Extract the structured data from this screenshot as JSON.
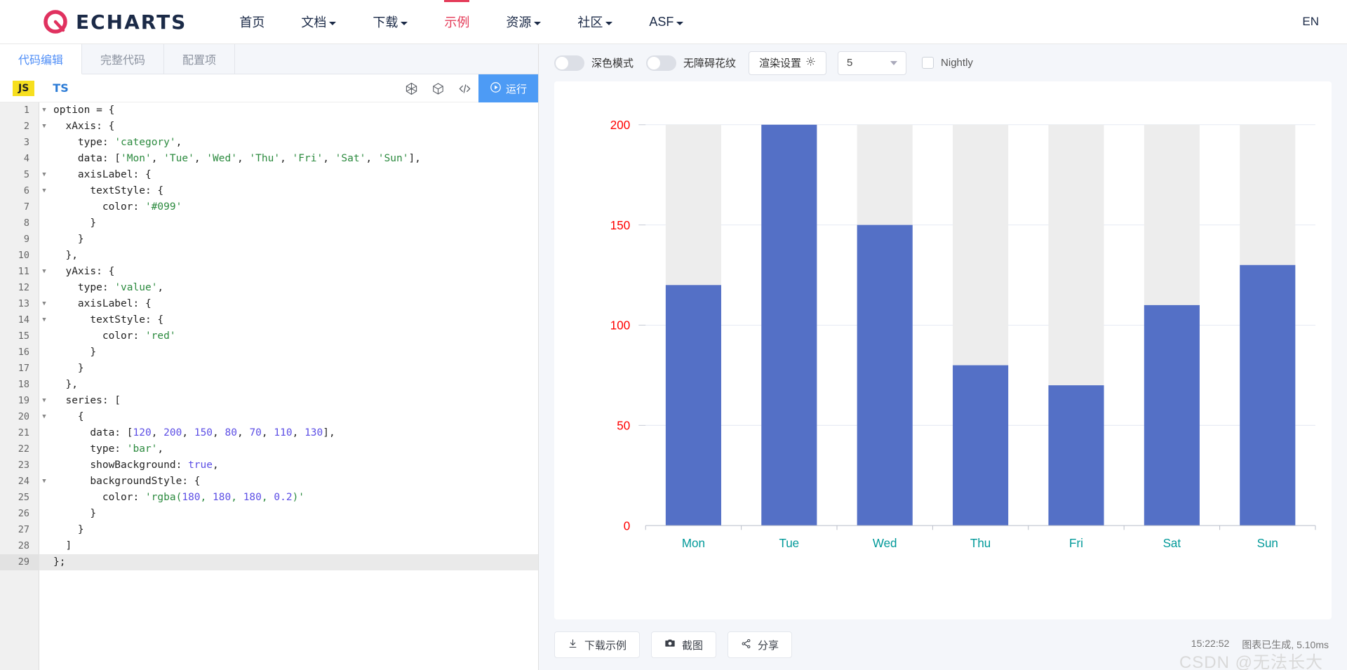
{
  "nav": {
    "brand": "ECHARTS",
    "items": [
      {
        "label": "首页",
        "dropdown": false,
        "active": false
      },
      {
        "label": "文档",
        "dropdown": true,
        "active": false
      },
      {
        "label": "下载",
        "dropdown": true,
        "active": false
      },
      {
        "label": "示例",
        "dropdown": false,
        "active": true
      },
      {
        "label": "资源",
        "dropdown": true,
        "active": false
      },
      {
        "label": "社区",
        "dropdown": true,
        "active": false
      },
      {
        "label": "ASF",
        "dropdown": true,
        "active": false
      }
    ],
    "lang_switch": "EN"
  },
  "editor": {
    "tabs": [
      {
        "label": "代码编辑",
        "active": true
      },
      {
        "label": "完整代码",
        "active": false
      },
      {
        "label": "配置项",
        "active": false
      }
    ],
    "lang_js": "JS",
    "lang_ts": "TS",
    "tool_icons": [
      "cube-wire-icon",
      "cube-icon",
      "code-brackets-icon"
    ],
    "run_label": "运行",
    "active_line": 29,
    "lines": [
      {
        "n": 1,
        "fold": true,
        "text": "option = {"
      },
      {
        "n": 2,
        "fold": true,
        "text": "  xAxis: {"
      },
      {
        "n": 3,
        "fold": false,
        "text": "    type: 'category',"
      },
      {
        "n": 4,
        "fold": false,
        "text": "    data: ['Mon', 'Tue', 'Wed', 'Thu', 'Fri', 'Sat', 'Sun'],"
      },
      {
        "n": 5,
        "fold": true,
        "text": "    axisLabel: {"
      },
      {
        "n": 6,
        "fold": true,
        "text": "      textStyle: {"
      },
      {
        "n": 7,
        "fold": false,
        "text": "        color: '#099'"
      },
      {
        "n": 8,
        "fold": false,
        "text": "      }"
      },
      {
        "n": 9,
        "fold": false,
        "text": "    }"
      },
      {
        "n": 10,
        "fold": false,
        "text": "  },"
      },
      {
        "n": 11,
        "fold": true,
        "text": "  yAxis: {"
      },
      {
        "n": 12,
        "fold": false,
        "text": "    type: 'value',"
      },
      {
        "n": 13,
        "fold": true,
        "text": "    axisLabel: {"
      },
      {
        "n": 14,
        "fold": true,
        "text": "      textStyle: {"
      },
      {
        "n": 15,
        "fold": false,
        "text": "        color: 'red'"
      },
      {
        "n": 16,
        "fold": false,
        "text": "      }"
      },
      {
        "n": 17,
        "fold": false,
        "text": "    }"
      },
      {
        "n": 18,
        "fold": false,
        "text": "  },"
      },
      {
        "n": 19,
        "fold": true,
        "text": "  series: ["
      },
      {
        "n": 20,
        "fold": true,
        "text": "    {"
      },
      {
        "n": 21,
        "fold": false,
        "text": "      data: [120, 200, 150, 80, 70, 110, 130],"
      },
      {
        "n": 22,
        "fold": false,
        "text": "      type: 'bar',"
      },
      {
        "n": 23,
        "fold": false,
        "text": "      showBackground: true,"
      },
      {
        "n": 24,
        "fold": true,
        "text": "      backgroundStyle: {"
      },
      {
        "n": 25,
        "fold": false,
        "text": "        color: 'rgba(180, 180, 180, 0.2)'"
      },
      {
        "n": 26,
        "fold": false,
        "text": "      }"
      },
      {
        "n": 27,
        "fold": false,
        "text": "    }"
      },
      {
        "n": 28,
        "fold": false,
        "text": "  ]"
      },
      {
        "n": 29,
        "fold": false,
        "text": "};"
      }
    ]
  },
  "preview": {
    "dark_mode_label": "深色模式",
    "dark_mode_on": false,
    "pattern_label": "无障碍花纹",
    "pattern_on": false,
    "render_settings_label": "渲染设置",
    "render_settings_icon": "gear-icon",
    "select_value": "5",
    "nightly_label": "Nightly",
    "nightly_checked": false,
    "buttons": [
      {
        "label": "下载示例",
        "icon": "download-icon"
      },
      {
        "label": "截图",
        "icon": "camera-icon"
      },
      {
        "label": "分享",
        "icon": "share-icon"
      }
    ],
    "status_time": "15:22:52",
    "status_message": "图表已生成, 5.10ms",
    "watermark": "CSDN @无法长大"
  },
  "chart_data": {
    "type": "bar",
    "title": "",
    "categories": [
      "Mon",
      "Tue",
      "Wed",
      "Thu",
      "Fri",
      "Sat",
      "Sun"
    ],
    "values": [
      120,
      200,
      150,
      80,
      70,
      110,
      130
    ],
    "ylim": [
      0,
      200
    ],
    "yticks": [
      0,
      50,
      100,
      150,
      200
    ],
    "xlabel": "",
    "ylabel": "",
    "grid": true,
    "legend": false,
    "bar_color": "#5470c6",
    "bar_background_color": "rgba(180, 180, 180, 0.2)",
    "x_label_color": "#099",
    "y_label_color": "red",
    "show_background": true
  }
}
